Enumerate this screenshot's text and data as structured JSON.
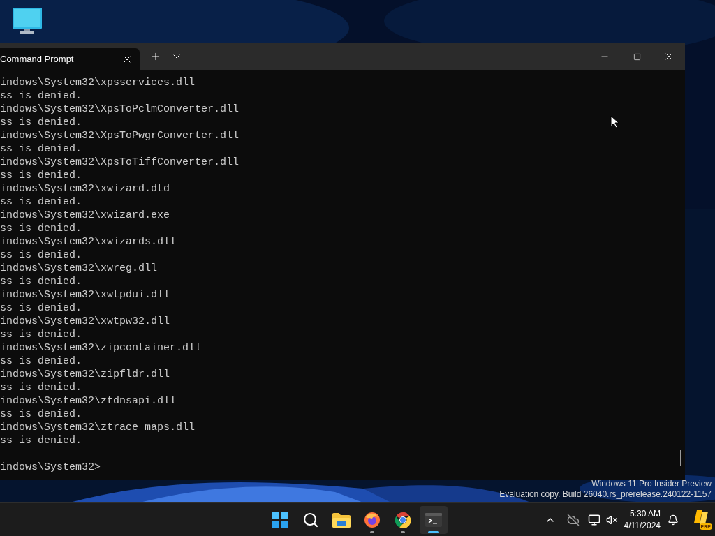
{
  "window": {
    "tab": {
      "title": "Command Prompt",
      "selected": true
    }
  },
  "terminal": {
    "lines": [
      "indows\\System32\\xpsservices.dll",
      "ss is denied.",
      "indows\\System32\\XpsToPclmConverter.dll",
      "ss is denied.",
      "indows\\System32\\XpsToPwgrConverter.dll",
      "ss is denied.",
      "indows\\System32\\XpsToTiffConverter.dll",
      "ss is denied.",
      "indows\\System32\\xwizard.dtd",
      "ss is denied.",
      "indows\\System32\\xwizard.exe",
      "ss is denied.",
      "indows\\System32\\xwizards.dll",
      "ss is denied.",
      "indows\\System32\\xwreg.dll",
      "ss is denied.",
      "indows\\System32\\xwtpdui.dll",
      "ss is denied.",
      "indows\\System32\\xwtpw32.dll",
      "ss is denied.",
      "indows\\System32\\zipcontainer.dll",
      "ss is denied.",
      "indows\\System32\\zipfldr.dll",
      "ss is denied.",
      "indows\\System32\\ztdnsapi.dll",
      "ss is denied.",
      "indows\\System32\\ztrace_maps.dll",
      "ss is denied."
    ],
    "prompt": "indows\\System32>"
  },
  "watermark": [
    "Windows 11 Pro Insider Preview",
    "Evaluation copy. Build 26040.rs_prerelease.240122-1157"
  ],
  "taskbar": {
    "apps": [
      {
        "kind": "start",
        "running": false,
        "selected": false
      },
      {
        "kind": "search",
        "running": false,
        "selected": false
      },
      {
        "kind": "explorer",
        "running": false,
        "selected": false
      },
      {
        "kind": "firefox",
        "running": true,
        "selected": false
      },
      {
        "kind": "chrome",
        "running": true,
        "selected": false
      },
      {
        "kind": "terminal",
        "running": true,
        "selected": true
      }
    ],
    "time": "5:30 AM",
    "date": "4/11/2024",
    "badge": "PRE"
  }
}
